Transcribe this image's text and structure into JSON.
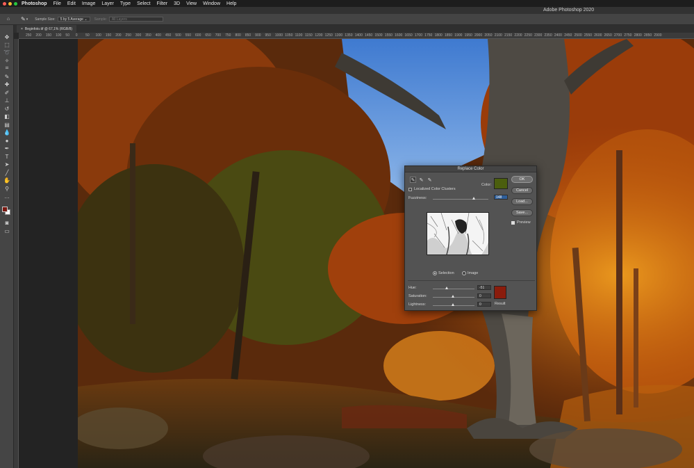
{
  "menubar": {
    "app_name": "Photoshop",
    "items": [
      "File",
      "Edit",
      "Image",
      "Layer",
      "Type",
      "Select",
      "Filter",
      "3D",
      "View",
      "Window",
      "Help"
    ]
  },
  "window": {
    "title": "Adobe Photoshop 2020"
  },
  "options_bar": {
    "sample_size_label": "Sample Size:",
    "sample_size_value": "5 by 5 Average",
    "sample_label": "Sample:",
    "sample_value": "All Layers"
  },
  "document": {
    "tab_label": "Beginfoto.tif @ 67,1% (RGB/8)"
  },
  "ruler": {
    "ticks": [
      "250",
      "200",
      "150",
      "100",
      "50",
      "0",
      "50",
      "100",
      "150",
      "200",
      "250",
      "300",
      "350",
      "400",
      "450",
      "500",
      "550",
      "600",
      "650",
      "700",
      "750",
      "800",
      "850",
      "900",
      "950",
      "1000",
      "1050",
      "1100",
      "1150",
      "1200",
      "1250",
      "1300",
      "1350",
      "1400",
      "1450",
      "1500",
      "1550",
      "1600",
      "1650",
      "1700",
      "1750",
      "1800",
      "1850",
      "1900",
      "1950",
      "2000",
      "2050",
      "2100",
      "2150",
      "2200",
      "2250",
      "2300",
      "2350",
      "2400",
      "2450",
      "2500",
      "2550",
      "2600",
      "2650",
      "2700",
      "2750",
      "2800",
      "2850",
      "2900"
    ]
  },
  "colors": {
    "foreground": "#7a1810",
    "background": "#ffffff",
    "sample_color": "#4b5e0e",
    "result_color": "#8a1c0c"
  },
  "dialog": {
    "title": "Replace Color",
    "localized_label": "Localized Color Clusters",
    "localized_checked": false,
    "color_label": "Color:",
    "fuzziness_label": "Fuzziness:",
    "fuzziness_value": "148",
    "fuzziness_max": 200,
    "buttons": {
      "ok": "OK",
      "cancel": "Cancel",
      "load": "Load...",
      "save": "Save..."
    },
    "preview_label": "Preview",
    "preview_checked": true,
    "view_selection_label": "Selection",
    "view_image_label": "Image",
    "view_selected": "Selection",
    "hue_label": "Hue:",
    "hue_value": "-51",
    "saturation_label": "Saturation:",
    "saturation_value": "0",
    "lightness_label": "Lightness:",
    "lightness_value": "0",
    "result_label": "Result"
  }
}
